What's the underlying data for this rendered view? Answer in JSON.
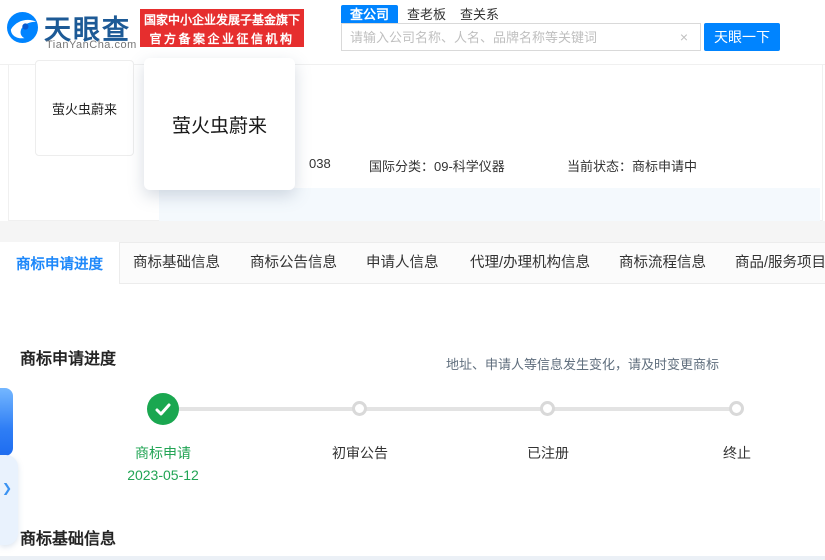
{
  "header": {
    "logo": {
      "title": "天眼查",
      "domain": "TianYanCha.com"
    },
    "badge": {
      "line1": "国家中小企业发展子基金旗下",
      "line2": "官方备案企业征信机构"
    },
    "search": {
      "tabs": [
        "查公司",
        "查老板",
        "查关系"
      ],
      "placeholder": "请输入公司名称、人名、品牌名称等关键词",
      "clear_icon": "×",
      "button": "天眼一下"
    }
  },
  "summary": {
    "thumb_text": "萤火虫蔚来",
    "popup_text": "萤火虫蔚来",
    "reg_no_partial": "038",
    "intl_class": "国际分类：09-科学仪器",
    "status": "当前状态：商标申请中",
    "notice": "地址、申请人等信息发生变化，请及时变更商标"
  },
  "tabs": {
    "items": [
      {
        "label": "商标申请进度",
        "active": true
      },
      {
        "label": "商标基础信息",
        "active": false
      },
      {
        "label": "商标公告信息",
        "active": false
      },
      {
        "label": "申请人信息",
        "active": false
      },
      {
        "label": "代理/办理机构信息",
        "active": false
      },
      {
        "label": "商标流程信息",
        "active": false
      },
      {
        "label": "商品/服务项目",
        "active": false
      }
    ]
  },
  "progress": {
    "title": "商标申请进度",
    "steps": [
      {
        "label": "商标申请",
        "date": "2023-05-12",
        "state": "done"
      },
      {
        "label": "初审公告",
        "state": "pending"
      },
      {
        "label": "已注册",
        "state": "pending"
      },
      {
        "label": "终止",
        "state": "pending"
      }
    ]
  },
  "basic_info": {
    "title": "商标基础信息"
  },
  "colors": {
    "brand_blue": "#0084ff",
    "badge_red": "#e62e2e",
    "done_green": "#1aa750"
  }
}
